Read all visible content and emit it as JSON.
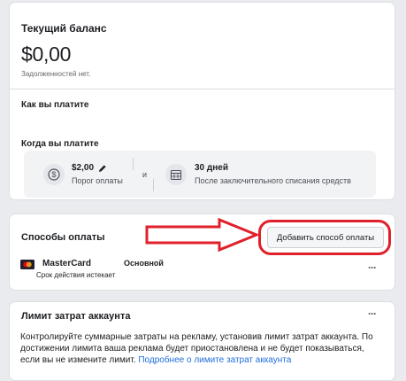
{
  "balance": {
    "title": "Текущий баланс",
    "amount": "$0,00",
    "note": "Задолженностей нет."
  },
  "payment_info": {
    "how_title": "Как вы платите",
    "when_title": "Когда вы платите",
    "threshold_value": "$2,00",
    "threshold_label": "Порог оплаты",
    "and": "и",
    "days_value": "30 дней",
    "days_label": "После заключительного списания средств"
  },
  "methods": {
    "title": "Способы оплаты",
    "add_button": "Добавить способ оплаты",
    "card_name": "MasterCard",
    "card_badge": "Основной",
    "card_expiry": "Срок действия истекает",
    "more": "···"
  },
  "limit": {
    "title": "Лимит затрат аккаунта",
    "more": "···",
    "text": "Контролируйте суммарные затраты на рекламу, установив лимит затрат аккаунта. По достижении лимита ваша реклама будет приостановлена и не будет показываться, если вы не измените лимит. ",
    "link": "Подробнее о лимите затрат аккаунта"
  },
  "colors": {
    "annotation_red": "#e0202a",
    "link_blue": "#216fdb",
    "background": "#e9ebee"
  },
  "icons": [
    "dollar-coin-icon",
    "pencil-icon",
    "calendar-icon",
    "mastercard-logo",
    "more-icon",
    "red-arrow-annotation"
  ]
}
